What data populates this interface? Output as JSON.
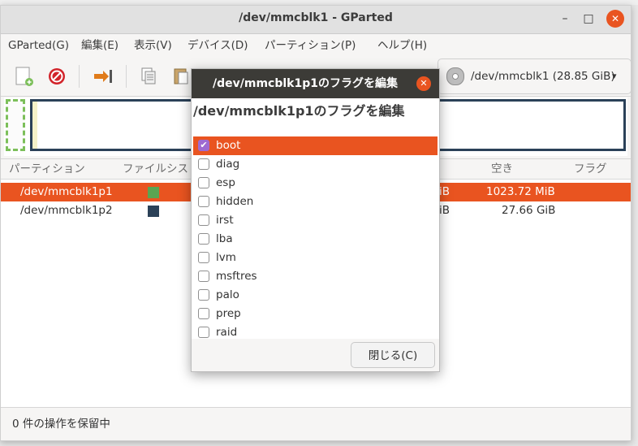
{
  "window": {
    "title": "/dev/mmcblk1 - GParted",
    "controls": [
      "–",
      "□",
      "✕"
    ]
  },
  "menu": [
    "GParted(G)",
    "編集(E)",
    "表示(V)",
    "デバイス(D)",
    "パーティション(P)",
    "ヘルプ(H)"
  ],
  "device_selector": {
    "label": "/dev/mmcblk1 (28.85 GiB)",
    "arrow": "▾"
  },
  "table": {
    "headers": [
      "パーティション",
      "ファイルシス",
      "空き",
      "フラグ"
    ],
    "rows": [
      {
        "partition": "/dev/mmcblk1p1",
        "color": "#5aa552",
        "used_suffix": "iB",
        "free": "1023.72 MiB",
        "selected": true
      },
      {
        "partition": "/dev/mmcblk1p2",
        "color": "#2b4158",
        "used_suffix": "iB",
        "free": "27.66 GiB",
        "selected": false
      }
    ]
  },
  "status": "0 件の操作を保留中",
  "dialog": {
    "title": "/dev/mmcblk1p1のフラグを編集",
    "close_symbol": "✕",
    "heading": "/dev/mmcblk1p1のフラグを編集",
    "flags": [
      {
        "label": "boot",
        "checked": true
      },
      {
        "label": "diag",
        "checked": false
      },
      {
        "label": "esp",
        "checked": false
      },
      {
        "label": "hidden",
        "checked": false
      },
      {
        "label": "irst",
        "checked": false
      },
      {
        "label": "lba",
        "checked": false
      },
      {
        "label": "lvm",
        "checked": false
      },
      {
        "label": "msftres",
        "checked": false
      },
      {
        "label": "palo",
        "checked": false
      },
      {
        "label": "prep",
        "checked": false
      },
      {
        "label": "raid",
        "checked": false
      }
    ],
    "close_button": "閉じる(C)"
  },
  "colors": {
    "accent": "#e95420",
    "check": "#9e6ad1",
    "dialog_title_bg": "#3c3b37"
  }
}
